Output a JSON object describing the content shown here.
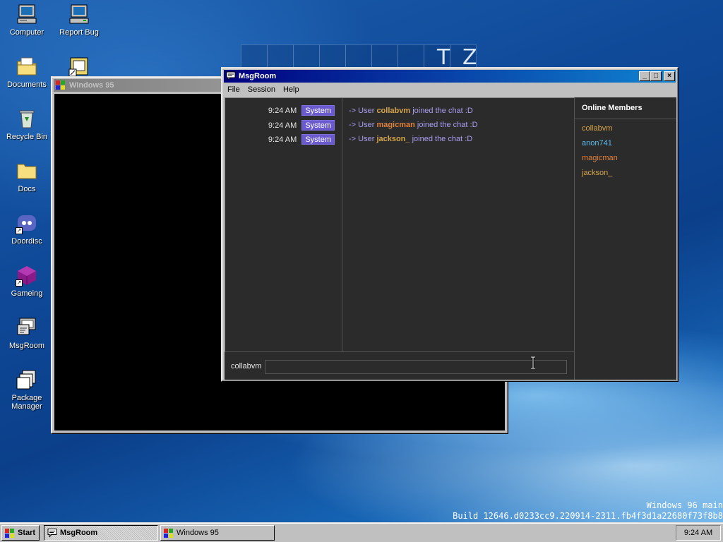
{
  "desktop": {
    "icons": [
      {
        "label": "Computer",
        "icon": "computer-icon"
      },
      {
        "label": "Report Bug",
        "icon": "report-bug-icon"
      },
      {
        "label": "Documents",
        "icon": "documents-folder-icon"
      },
      {
        "label": "Recycle Bin",
        "icon": "recycle-bin-icon"
      },
      {
        "label": "Docs",
        "icon": "folder-icon"
      },
      {
        "label": "Doordisc",
        "icon": "doordisc-icon"
      },
      {
        "label": "Gameing",
        "icon": "gameing-icon"
      },
      {
        "label": "MsgRoom",
        "icon": "msgroom-icon"
      },
      {
        "label": "Package Manager",
        "icon": "package-manager-icon"
      }
    ],
    "ghost_letters": [
      "T",
      "Z"
    ],
    "build_line1": "Windows 96 main",
    "build_line2": "Build 12646.d0233cc9.220914-2311.fb4f3d1a22680f73f8b8"
  },
  "win95_window": {
    "title": "Windows 95"
  },
  "msgroom_window": {
    "title": "MsgRoom",
    "menu": [
      "File",
      "Session",
      "Help"
    ],
    "messages": [
      {
        "time": "9:24 AM",
        "badge": "System",
        "prefix": "-> User",
        "user": "collabvm",
        "suffix": "joined the chat :D",
        "user_color": "#d6a54a"
      },
      {
        "time": "9:24 AM",
        "badge": "System",
        "prefix": "-> User",
        "user": "magicman",
        "suffix": "joined the chat :D",
        "user_color": "#e0803c"
      },
      {
        "time": "9:24 AM",
        "badge": "System",
        "prefix": "-> User",
        "user": "jackson_",
        "suffix": "joined the chat :D",
        "user_color": "#d6a54a"
      }
    ],
    "input_label": "collabvm",
    "input_value": "",
    "members_heading": "Online Members",
    "members": [
      {
        "name": "collabvm",
        "color": "#d6a54a"
      },
      {
        "name": "anon741",
        "color": "#5bbcf0"
      },
      {
        "name": "magicman",
        "color": "#e0803c"
      },
      {
        "name": "jackson_",
        "color": "#d6a54a"
      }
    ]
  },
  "taskbar": {
    "start_label": "Start",
    "tasks": [
      {
        "label": "MsgRoom",
        "active": true
      },
      {
        "label": "Windows 95",
        "active": false
      }
    ],
    "clock": "9:24 AM"
  }
}
